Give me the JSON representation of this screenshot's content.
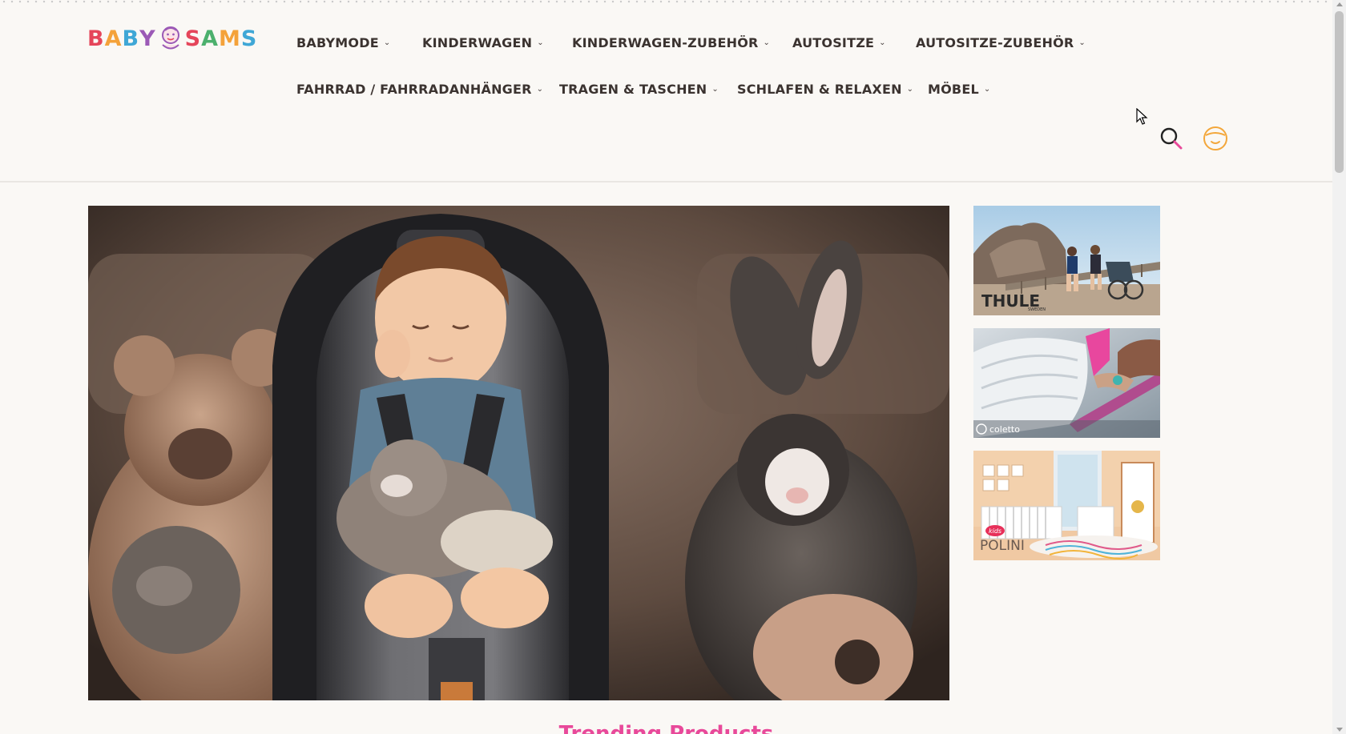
{
  "brand": {
    "logo_text_left": "BABY",
    "logo_text_right": "SAMS",
    "logo_letter_colors": [
      "#e5455a",
      "#f4a23a",
      "#3fa7d6",
      "#9b59b6",
      "#e5455a",
      "#4cb06d",
      "#f4a23a",
      "#3fa7d6"
    ]
  },
  "nav": {
    "row1": [
      {
        "label": "BABYMODE",
        "icon": "chevron-down-icon"
      },
      {
        "label": "KINDERWAGEN",
        "icon": "chevron-down-icon"
      },
      {
        "label": "KINDERWAGEN-ZUBEHÖR",
        "icon": "chevron-down-icon"
      },
      {
        "label": "AUTOSITZE",
        "icon": "chevron-down-icon"
      },
      {
        "label": "AUTOSITZE-ZUBEHÖR",
        "icon": "chevron-down-icon"
      }
    ],
    "row2": [
      {
        "label": "FAHRRAD / FAHRRADANHÄNGER",
        "icon": "chevron-down-icon"
      },
      {
        "label": "TRAGEN & TASCHEN",
        "icon": "chevron-down-icon"
      },
      {
        "label": "SCHLAFEN & RELAXEN",
        "icon": "chevron-down-icon"
      },
      {
        "label": "MÖBEL",
        "icon": "chevron-down-icon"
      }
    ],
    "chevron_glyph": "⌄"
  },
  "header_icons": {
    "search": "search-icon",
    "account": "account-face-icon"
  },
  "side_banners": [
    {
      "brand_label": "THULE",
      "brand_sub": "SWEDEN"
    },
    {
      "brand_label": "coletto"
    },
    {
      "brand_label": "POLINI",
      "brand_badge": "kids"
    }
  ],
  "sections": {
    "trending_title": "Trending Products"
  },
  "colors": {
    "accent_pink": "#e8499a",
    "nav_text": "#3b3330",
    "account_icon": "#f3a73b",
    "background": "#faf8f5"
  }
}
